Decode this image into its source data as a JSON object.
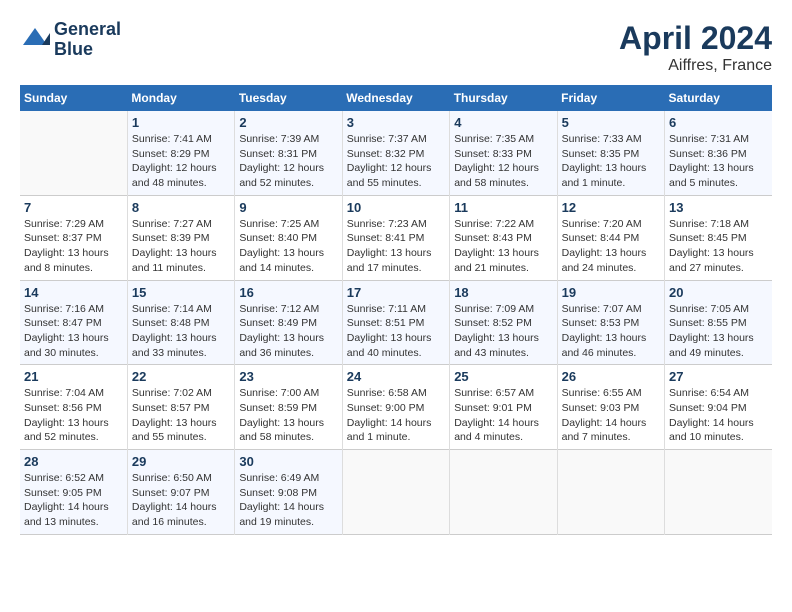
{
  "header": {
    "logo_line1": "General",
    "logo_line2": "Blue",
    "title": "April 2024",
    "subtitle": "Aiffres, France"
  },
  "days_of_week": [
    "Sunday",
    "Monday",
    "Tuesday",
    "Wednesday",
    "Thursday",
    "Friday",
    "Saturday"
  ],
  "weeks": [
    [
      {
        "num": "",
        "sunrise": "",
        "sunset": "",
        "daylight": ""
      },
      {
        "num": "1",
        "sunrise": "Sunrise: 7:41 AM",
        "sunset": "Sunset: 8:29 PM",
        "daylight": "Daylight: 12 hours and 48 minutes."
      },
      {
        "num": "2",
        "sunrise": "Sunrise: 7:39 AM",
        "sunset": "Sunset: 8:31 PM",
        "daylight": "Daylight: 12 hours and 52 minutes."
      },
      {
        "num": "3",
        "sunrise": "Sunrise: 7:37 AM",
        "sunset": "Sunset: 8:32 PM",
        "daylight": "Daylight: 12 hours and 55 minutes."
      },
      {
        "num": "4",
        "sunrise": "Sunrise: 7:35 AM",
        "sunset": "Sunset: 8:33 PM",
        "daylight": "Daylight: 12 hours and 58 minutes."
      },
      {
        "num": "5",
        "sunrise": "Sunrise: 7:33 AM",
        "sunset": "Sunset: 8:35 PM",
        "daylight": "Daylight: 13 hours and 1 minute."
      },
      {
        "num": "6",
        "sunrise": "Sunrise: 7:31 AM",
        "sunset": "Sunset: 8:36 PM",
        "daylight": "Daylight: 13 hours and 5 minutes."
      }
    ],
    [
      {
        "num": "7",
        "sunrise": "Sunrise: 7:29 AM",
        "sunset": "Sunset: 8:37 PM",
        "daylight": "Daylight: 13 hours and 8 minutes."
      },
      {
        "num": "8",
        "sunrise": "Sunrise: 7:27 AM",
        "sunset": "Sunset: 8:39 PM",
        "daylight": "Daylight: 13 hours and 11 minutes."
      },
      {
        "num": "9",
        "sunrise": "Sunrise: 7:25 AM",
        "sunset": "Sunset: 8:40 PM",
        "daylight": "Daylight: 13 hours and 14 minutes."
      },
      {
        "num": "10",
        "sunrise": "Sunrise: 7:23 AM",
        "sunset": "Sunset: 8:41 PM",
        "daylight": "Daylight: 13 hours and 17 minutes."
      },
      {
        "num": "11",
        "sunrise": "Sunrise: 7:22 AM",
        "sunset": "Sunset: 8:43 PM",
        "daylight": "Daylight: 13 hours and 21 minutes."
      },
      {
        "num": "12",
        "sunrise": "Sunrise: 7:20 AM",
        "sunset": "Sunset: 8:44 PM",
        "daylight": "Daylight: 13 hours and 24 minutes."
      },
      {
        "num": "13",
        "sunrise": "Sunrise: 7:18 AM",
        "sunset": "Sunset: 8:45 PM",
        "daylight": "Daylight: 13 hours and 27 minutes."
      }
    ],
    [
      {
        "num": "14",
        "sunrise": "Sunrise: 7:16 AM",
        "sunset": "Sunset: 8:47 PM",
        "daylight": "Daylight: 13 hours and 30 minutes."
      },
      {
        "num": "15",
        "sunrise": "Sunrise: 7:14 AM",
        "sunset": "Sunset: 8:48 PM",
        "daylight": "Daylight: 13 hours and 33 minutes."
      },
      {
        "num": "16",
        "sunrise": "Sunrise: 7:12 AM",
        "sunset": "Sunset: 8:49 PM",
        "daylight": "Daylight: 13 hours and 36 minutes."
      },
      {
        "num": "17",
        "sunrise": "Sunrise: 7:11 AM",
        "sunset": "Sunset: 8:51 PM",
        "daylight": "Daylight: 13 hours and 40 minutes."
      },
      {
        "num": "18",
        "sunrise": "Sunrise: 7:09 AM",
        "sunset": "Sunset: 8:52 PM",
        "daylight": "Daylight: 13 hours and 43 minutes."
      },
      {
        "num": "19",
        "sunrise": "Sunrise: 7:07 AM",
        "sunset": "Sunset: 8:53 PM",
        "daylight": "Daylight: 13 hours and 46 minutes."
      },
      {
        "num": "20",
        "sunrise": "Sunrise: 7:05 AM",
        "sunset": "Sunset: 8:55 PM",
        "daylight": "Daylight: 13 hours and 49 minutes."
      }
    ],
    [
      {
        "num": "21",
        "sunrise": "Sunrise: 7:04 AM",
        "sunset": "Sunset: 8:56 PM",
        "daylight": "Daylight: 13 hours and 52 minutes."
      },
      {
        "num": "22",
        "sunrise": "Sunrise: 7:02 AM",
        "sunset": "Sunset: 8:57 PM",
        "daylight": "Daylight: 13 hours and 55 minutes."
      },
      {
        "num": "23",
        "sunrise": "Sunrise: 7:00 AM",
        "sunset": "Sunset: 8:59 PM",
        "daylight": "Daylight: 13 hours and 58 minutes."
      },
      {
        "num": "24",
        "sunrise": "Sunrise: 6:58 AM",
        "sunset": "Sunset: 9:00 PM",
        "daylight": "Daylight: 14 hours and 1 minute."
      },
      {
        "num": "25",
        "sunrise": "Sunrise: 6:57 AM",
        "sunset": "Sunset: 9:01 PM",
        "daylight": "Daylight: 14 hours and 4 minutes."
      },
      {
        "num": "26",
        "sunrise": "Sunrise: 6:55 AM",
        "sunset": "Sunset: 9:03 PM",
        "daylight": "Daylight: 14 hours and 7 minutes."
      },
      {
        "num": "27",
        "sunrise": "Sunrise: 6:54 AM",
        "sunset": "Sunset: 9:04 PM",
        "daylight": "Daylight: 14 hours and 10 minutes."
      }
    ],
    [
      {
        "num": "28",
        "sunrise": "Sunrise: 6:52 AM",
        "sunset": "Sunset: 9:05 PM",
        "daylight": "Daylight: 14 hours and 13 minutes."
      },
      {
        "num": "29",
        "sunrise": "Sunrise: 6:50 AM",
        "sunset": "Sunset: 9:07 PM",
        "daylight": "Daylight: 14 hours and 16 minutes."
      },
      {
        "num": "30",
        "sunrise": "Sunrise: 6:49 AM",
        "sunset": "Sunset: 9:08 PM",
        "daylight": "Daylight: 14 hours and 19 minutes."
      },
      {
        "num": "",
        "sunrise": "",
        "sunset": "",
        "daylight": ""
      },
      {
        "num": "",
        "sunrise": "",
        "sunset": "",
        "daylight": ""
      },
      {
        "num": "",
        "sunrise": "",
        "sunset": "",
        "daylight": ""
      },
      {
        "num": "",
        "sunrise": "",
        "sunset": "",
        "daylight": ""
      }
    ]
  ]
}
